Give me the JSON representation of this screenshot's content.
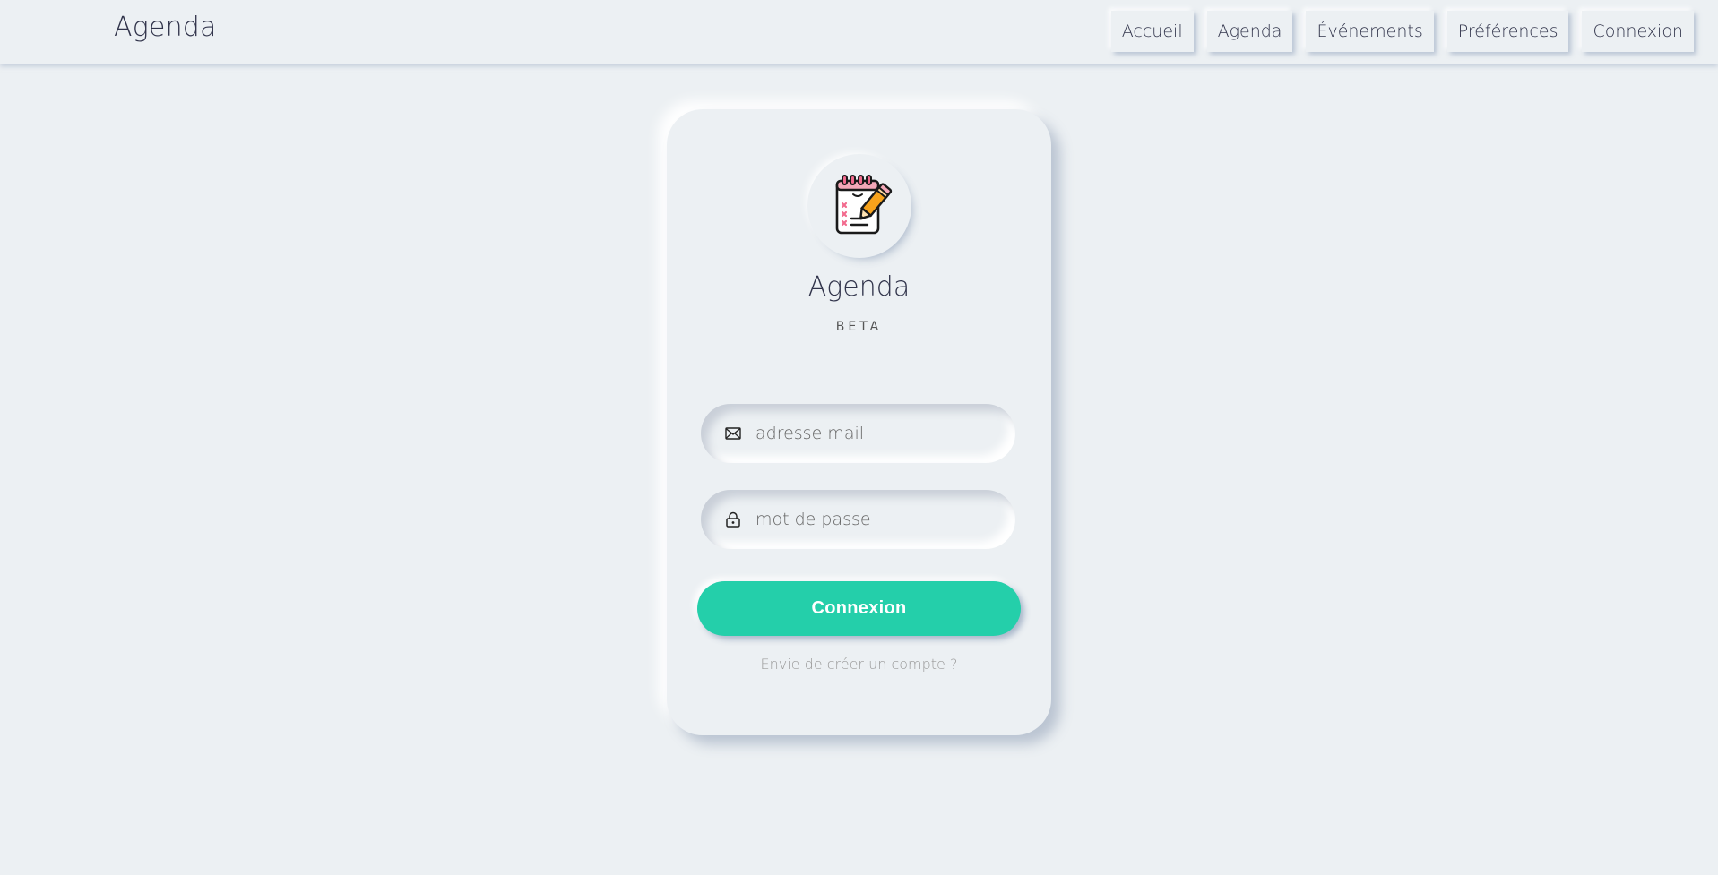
{
  "navbar": {
    "brand": "Agenda",
    "links": [
      {
        "label": "Accueil"
      },
      {
        "label": "Agenda"
      },
      {
        "label": "Événements"
      },
      {
        "label": "Préférences"
      },
      {
        "label": "Connexion"
      }
    ]
  },
  "card": {
    "logo_icon": "notepad-pencil-icon",
    "title": "Agenda",
    "subtitle": "BETA",
    "email": {
      "icon": "envelope-icon",
      "placeholder": "adresse mail",
      "value": ""
    },
    "password": {
      "icon": "lock-icon",
      "placeholder": "mot de passe",
      "value": ""
    },
    "submit_label": "Connexion",
    "signup_text": "Envie de créer un compte ?"
  },
  "colors": {
    "background": "#ecf0f3",
    "accent": "#24cfaa",
    "text": "#31344b"
  }
}
